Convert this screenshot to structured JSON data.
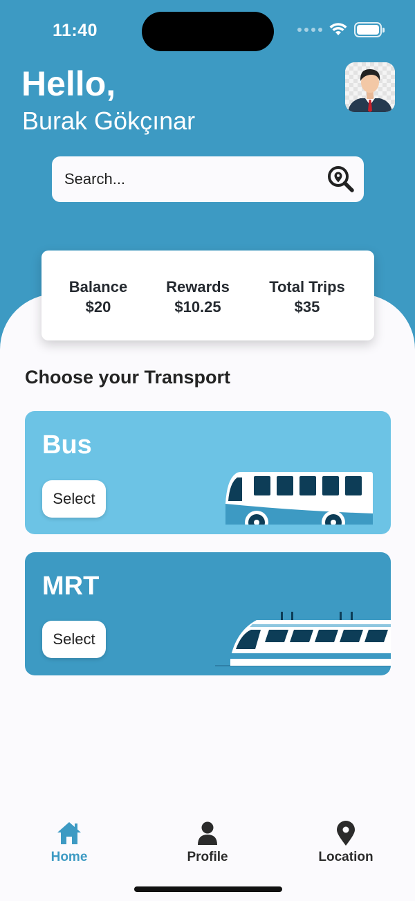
{
  "status_bar": {
    "time": "11:40"
  },
  "header": {
    "greeting": "Hello,",
    "user_name": "Burak Gökçınar"
  },
  "search": {
    "placeholder": "Search..."
  },
  "stats": [
    {
      "label": "Balance",
      "value": "$20"
    },
    {
      "label": "Rewards",
      "value": "$10.25"
    },
    {
      "label": "Total Trips",
      "value": "$35"
    }
  ],
  "section": {
    "title": "Choose your Transport"
  },
  "transports": [
    {
      "title": "Bus",
      "button_label": "Select",
      "icon": "bus-icon"
    },
    {
      "title": "MRT",
      "button_label": "Select",
      "icon": "train-icon"
    }
  ],
  "tabbar": {
    "items": [
      {
        "label": "Home",
        "icon": "home-icon",
        "active": true
      },
      {
        "label": "Profile",
        "icon": "person-icon",
        "active": false
      },
      {
        "label": "Location",
        "icon": "location-pin-icon",
        "active": false
      }
    ]
  },
  "colors": {
    "primary": "#3d9ac3",
    "light_accent": "#6cc3e5",
    "background": "#fbfafd",
    "text_dark": "#222222"
  }
}
